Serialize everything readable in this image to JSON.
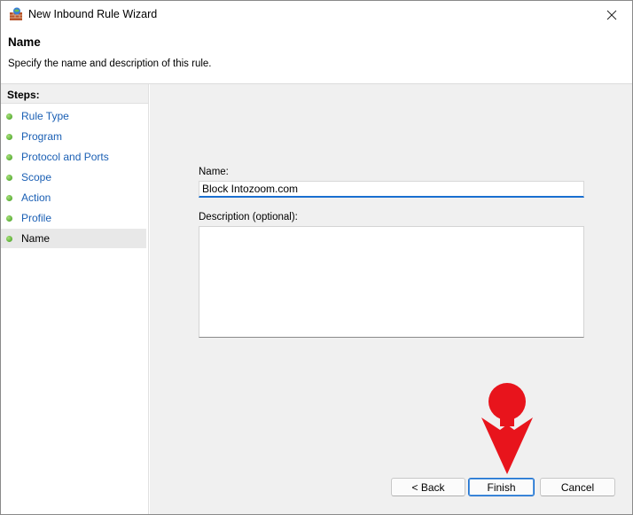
{
  "window": {
    "title": "New Inbound Rule Wizard"
  },
  "header": {
    "title": "Name",
    "subtitle": "Specify the name and description of this rule."
  },
  "steps": {
    "heading": "Steps:",
    "items": [
      {
        "label": "Rule Type"
      },
      {
        "label": "Program"
      },
      {
        "label": "Protocol and Ports"
      },
      {
        "label": "Scope"
      },
      {
        "label": "Action"
      },
      {
        "label": "Profile"
      },
      {
        "label": "Name"
      }
    ],
    "active_item": "Name"
  },
  "form": {
    "name_label": "Name:",
    "name_value": "Block Intozoom.com",
    "description_label": "Description (optional):",
    "description_value": ""
  },
  "buttons": {
    "back": "< Back",
    "finish": "Finish",
    "cancel": "Cancel"
  },
  "colors": {
    "accent": "#1a6fd0",
    "link": "#1a5fb4",
    "step_dot": "#3c9a1c",
    "annotation_arrow": "#e8141c",
    "content_bg": "#f0f0f0"
  },
  "icons": {
    "app": "firewall-icon",
    "close": "close-icon",
    "step": "green-dot-icon",
    "annotation": "red-arrow-pointer"
  }
}
